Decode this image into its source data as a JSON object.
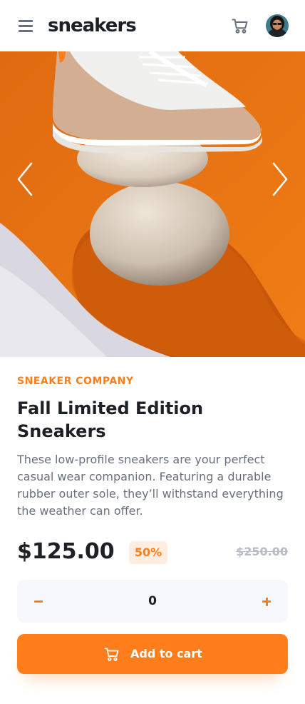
{
  "header": {
    "logo": "sneakers",
    "menu_icon": "hamburger-menu-icon",
    "cart_icon": "cart-icon",
    "avatar_icon": "user-avatar"
  },
  "gallery": {
    "prev_icon": "chevron-left-icon",
    "next_icon": "chevron-right-icon"
  },
  "product": {
    "company": "SNEAKER COMPANY",
    "title": "Fall Limited Edition Sneakers",
    "description": "These low-profile sneakers are your perfect casual wear companion. Featuring a durable rubber outer sole, they’ll withstand everything the weather can offer.",
    "price": "$125.00",
    "discount": "50%",
    "original_price": "$250.00"
  },
  "quantity": {
    "value": "0",
    "minus_icon": "minus-icon",
    "plus_icon": "plus-icon"
  },
  "cart_button": {
    "label": "Add to cart",
    "icon": "cart-icon"
  },
  "colors": {
    "accent": "#ff7e1b",
    "accent_pale": "#ffede0",
    "text_dark": "#1d2026",
    "text_grey": "#69707d",
    "text_light": "#b6bcc8",
    "panel_bg": "#f6f8fd"
  }
}
